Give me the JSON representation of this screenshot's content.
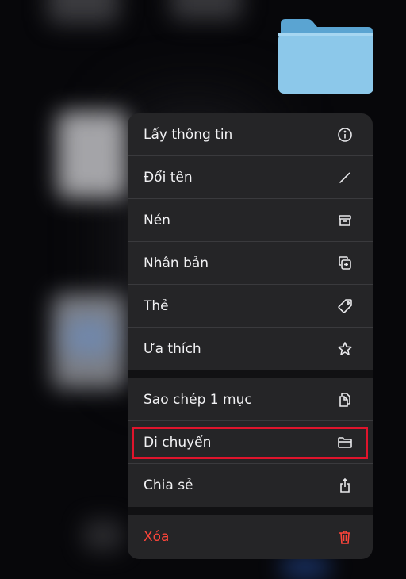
{
  "menu": {
    "items": [
      {
        "label": "Lấy thông tin",
        "icon": "info-icon"
      },
      {
        "label": "Đổi tên",
        "icon": "pencil-icon"
      },
      {
        "label": "Nén",
        "icon": "archive-box-icon"
      },
      {
        "label": "Nhân bản",
        "icon": "duplicate-icon"
      },
      {
        "label": "Thẻ",
        "icon": "tag-icon"
      },
      {
        "label": "Ưa thích",
        "icon": "star-icon"
      },
      {
        "label": "Sao chép 1 mục",
        "icon": "copy-document-icon"
      },
      {
        "label": "Di chuyển",
        "icon": "folder-icon"
      },
      {
        "label": "Chia sẻ",
        "icon": "share-icon"
      },
      {
        "label": "Xóa",
        "icon": "trash-icon"
      }
    ]
  },
  "colors": {
    "menu_background": "#252527",
    "destructive": "#ff453a",
    "highlight_border": "#e0142c",
    "folder": "#8cc8ea"
  }
}
